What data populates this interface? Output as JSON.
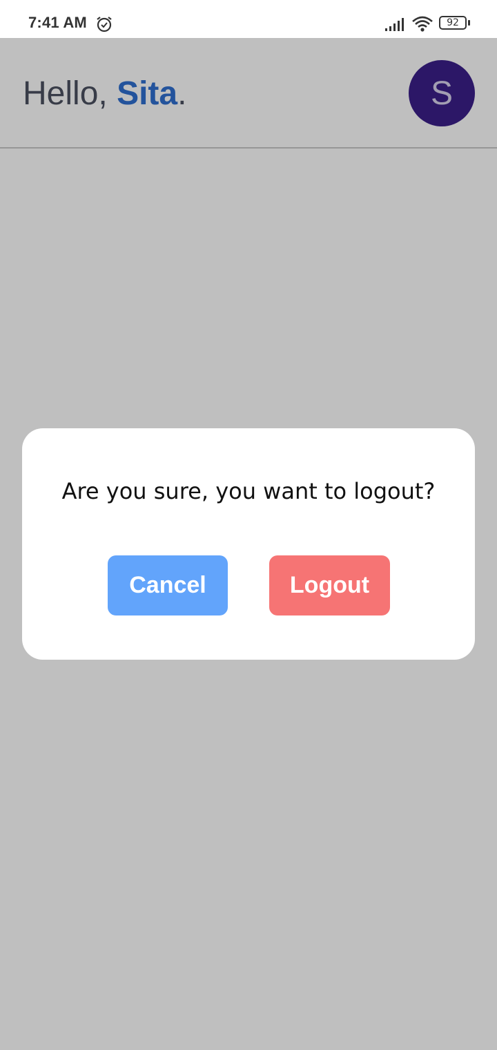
{
  "status_bar": {
    "time": "7:41 AM",
    "battery_level": "92",
    "icons": [
      "alarm-icon",
      "signal-icon",
      "wifi-icon",
      "battery-icon"
    ]
  },
  "header": {
    "greeting_prefix": "Hello, ",
    "user_name": "Sita",
    "greeting_suffix": ".",
    "avatar_initial": "S"
  },
  "dialog": {
    "message": "Are you sure, you want to logout?",
    "cancel_label": "Cancel",
    "logout_label": "Logout"
  },
  "colors": {
    "name_accent": "#2f6fd0",
    "avatar_bg": "#3b1f8a",
    "cancel_button": "#62a4fb",
    "logout_button": "#f67474"
  }
}
